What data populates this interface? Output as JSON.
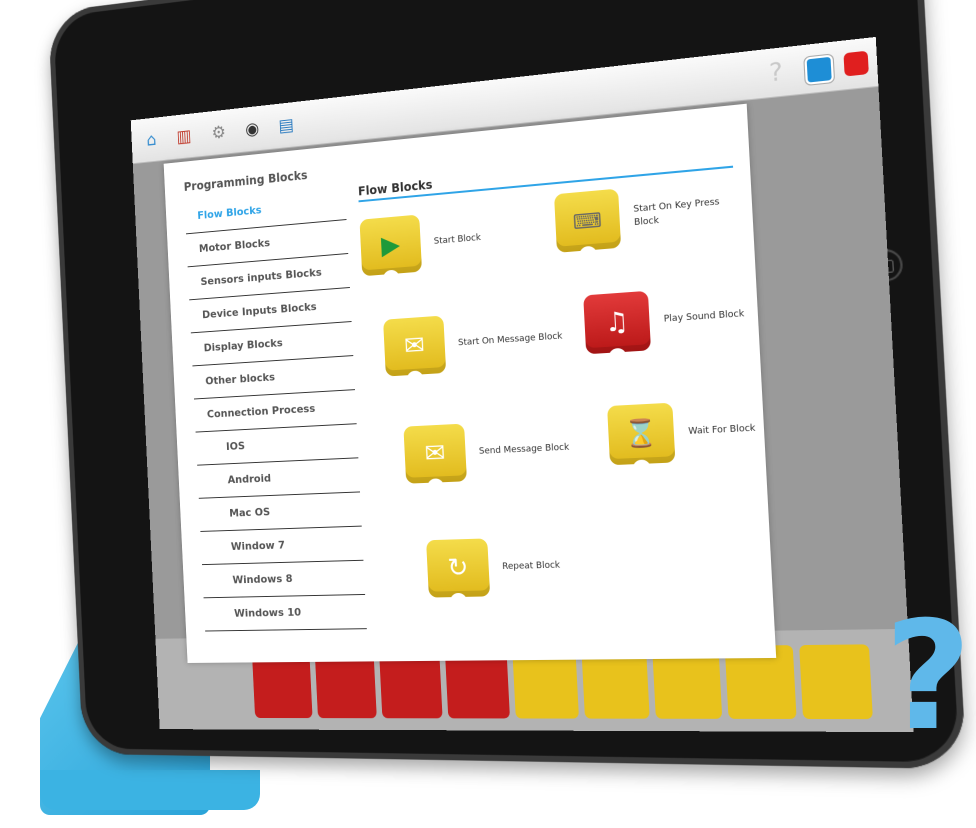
{
  "toolbar": {
    "icons": [
      "home-icon",
      "books-icon",
      "gear-icon",
      "camera-icon",
      "notes-icon",
      "help-icon",
      "blue-square-icon",
      "red-square-icon"
    ],
    "help_glyph": "?"
  },
  "nav": {
    "title": "Programming Blocks",
    "items": [
      {
        "label": "Flow Blocks"
      },
      {
        "label": "Motor Blocks"
      },
      {
        "label": "Sensors inputs Blocks"
      },
      {
        "label": "Device Inputs Blocks"
      },
      {
        "label": "Display Blocks"
      },
      {
        "label": "Other blocks"
      },
      {
        "label": "Connection Process"
      },
      {
        "label": "IOS"
      },
      {
        "label": "Android"
      },
      {
        "label": "Mac OS"
      },
      {
        "label": "Window 7"
      },
      {
        "label": "Windows 8"
      },
      {
        "label": "Windows 10"
      }
    ]
  },
  "content": {
    "title": "Flow Blocks",
    "blocks": [
      {
        "label": "Start Block",
        "icon": "play-icon",
        "color": "#e8c21c"
      },
      {
        "label": "Start On Key Press Block",
        "icon": "key-icon",
        "color": "#e8c21c"
      },
      {
        "label": "Start On Message Block",
        "icon": "envelope-open-icon",
        "color": "#e8c21c"
      },
      {
        "label": "Play Sound Block",
        "icon": "music-note-icon",
        "color": "#c41d1d"
      },
      {
        "label": "Send Message Block",
        "icon": "envelope-icon",
        "color": "#e8c21c"
      },
      {
        "label": "Wait For Block",
        "icon": "hourglass-icon",
        "color": "#e8c21c"
      },
      {
        "label": "Repeat Block",
        "icon": "repeat-icon",
        "color": "#e8c21c"
      }
    ]
  },
  "big_help_glyph": "?",
  "colors": {
    "accent": "#2fa4e7",
    "block_yellow": "#e8c21c",
    "block_red": "#c41d1d",
    "cover_blue": "#3bb3e3"
  }
}
